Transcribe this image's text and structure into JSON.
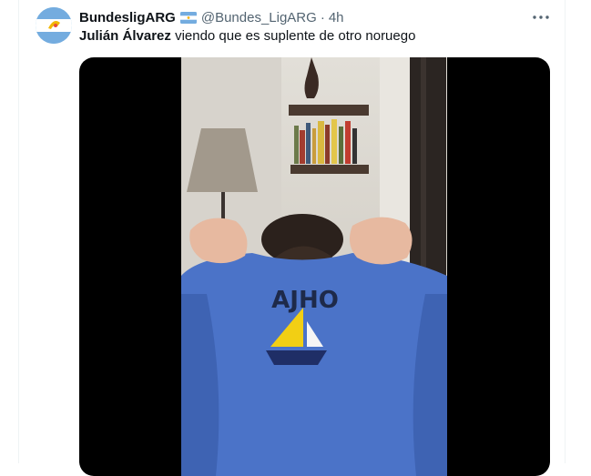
{
  "tweet": {
    "author_name": "BundesligARG",
    "author_handle": "@Bundes_LigARG",
    "separator": "·",
    "timestamp": "4h",
    "text_bold": "Julián Álvarez",
    "text_rest": "viendo que es suplente de otro noruego"
  },
  "media": {
    "shirt_text": "AJHO"
  },
  "icons": {
    "avatar": "bundesligarg-avatar",
    "flag": "argentina-flag-icon",
    "more": "more-options-icon"
  },
  "colors": {
    "text_primary": "#0f1419",
    "text_secondary": "#536471",
    "shirt_blue": "#4b73c8",
    "sail_yellow": "#f2cf14",
    "flag_blue": "#74acdf"
  }
}
